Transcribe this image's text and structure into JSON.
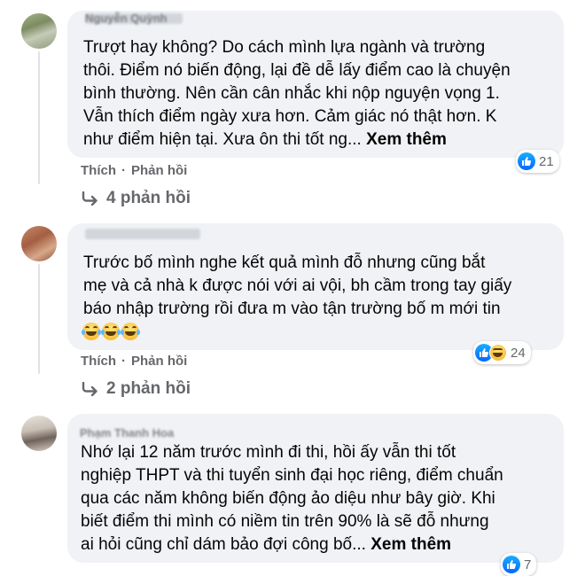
{
  "comments": [
    {
      "name": "Nguyễn Quỳnh",
      "text": "Trượt hay không? Do cách mình lựa ngành và trường\nthôi. Điểm nó biến động, lại đề dễ lấy điểm cao là chuyện\nbình thường. Nên cần cân nhắc khi nộp nguyện vọng 1.\nVẫn thích điểm ngày xưa hơn. Cảm giác nó thật hơn. K\nnhư điểm hiện tại. Xưa ôn thi tốt ng...",
      "see_more": "Xem thêm",
      "like_label": "Thích",
      "reply_label": "Phản hồi",
      "reaction_count": "21",
      "replies_label": "4 phản hồi"
    },
    {
      "name": "",
      "text": "Trước bố mình nghe kết quả mình đỗ nhưng cũng bắt\nmẹ và cả nhà k được nói với ai vội, bh cầm trong tay giấy\nbáo nhập trường rồi đưa m vào tận trường bố m mới tin",
      "like_label": "Thích",
      "reply_label": "Phản hồi",
      "reaction_count": "24",
      "replies_label": "2 phản hồi"
    },
    {
      "name": "Phạm Thanh Hoa",
      "text": "Nhớ lại 12 năm trước mình đi thi, hồi ấy vẫn thi tốt\nnghiệp THPT và thi tuyển sinh đại học riêng, điểm chuẩn\nqua các năm không biến động ảo diệu như bây giờ. Khi\nbiết điểm thi mình có niềm tin trên 90% là sẽ đỗ nhưng\nai hỏi cũng chỉ dám bảo đợi công bố...",
      "see_more": "Xem thêm",
      "reaction_count": "7"
    }
  ],
  "separator": "·",
  "icons": [
    "like-icon",
    "haha-icon",
    "reply-arrow-icon",
    "laughing-emoji-icon"
  ],
  "colors": {
    "bubble": "#f0f2f5",
    "secondary_text": "#65676b",
    "like_blue": "#0866ff"
  }
}
